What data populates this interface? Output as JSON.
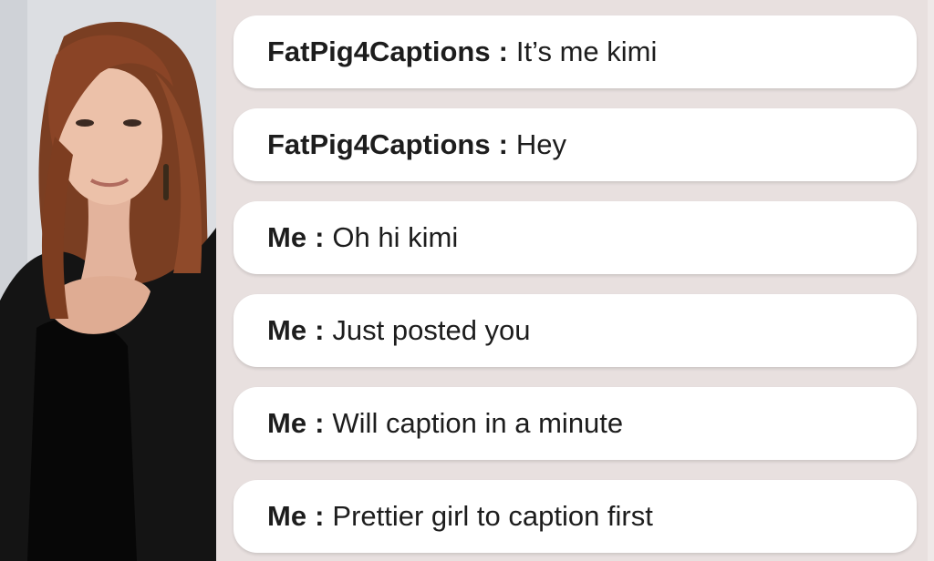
{
  "messages": [
    {
      "sender": "FatPig4Captions",
      "separator": ":",
      "text": "It’s me kimi"
    },
    {
      "sender": "FatPig4Captions",
      "separator": ":",
      "text": "Hey"
    },
    {
      "sender": "Me",
      "separator": ":",
      "text": "Oh hi kimi"
    },
    {
      "sender": "Me",
      "separator": ":",
      "text": "Just posted you"
    },
    {
      "sender": "Me",
      "separator": ":",
      "text": "Will caption in a minute"
    },
    {
      "sender": "Me",
      "separator": ":",
      "text": "Prettier girl to caption first"
    }
  ],
  "colors": {
    "chat_background": "#e8e0df",
    "bubble": "#ffffff",
    "text": "#1d1d1d"
  }
}
